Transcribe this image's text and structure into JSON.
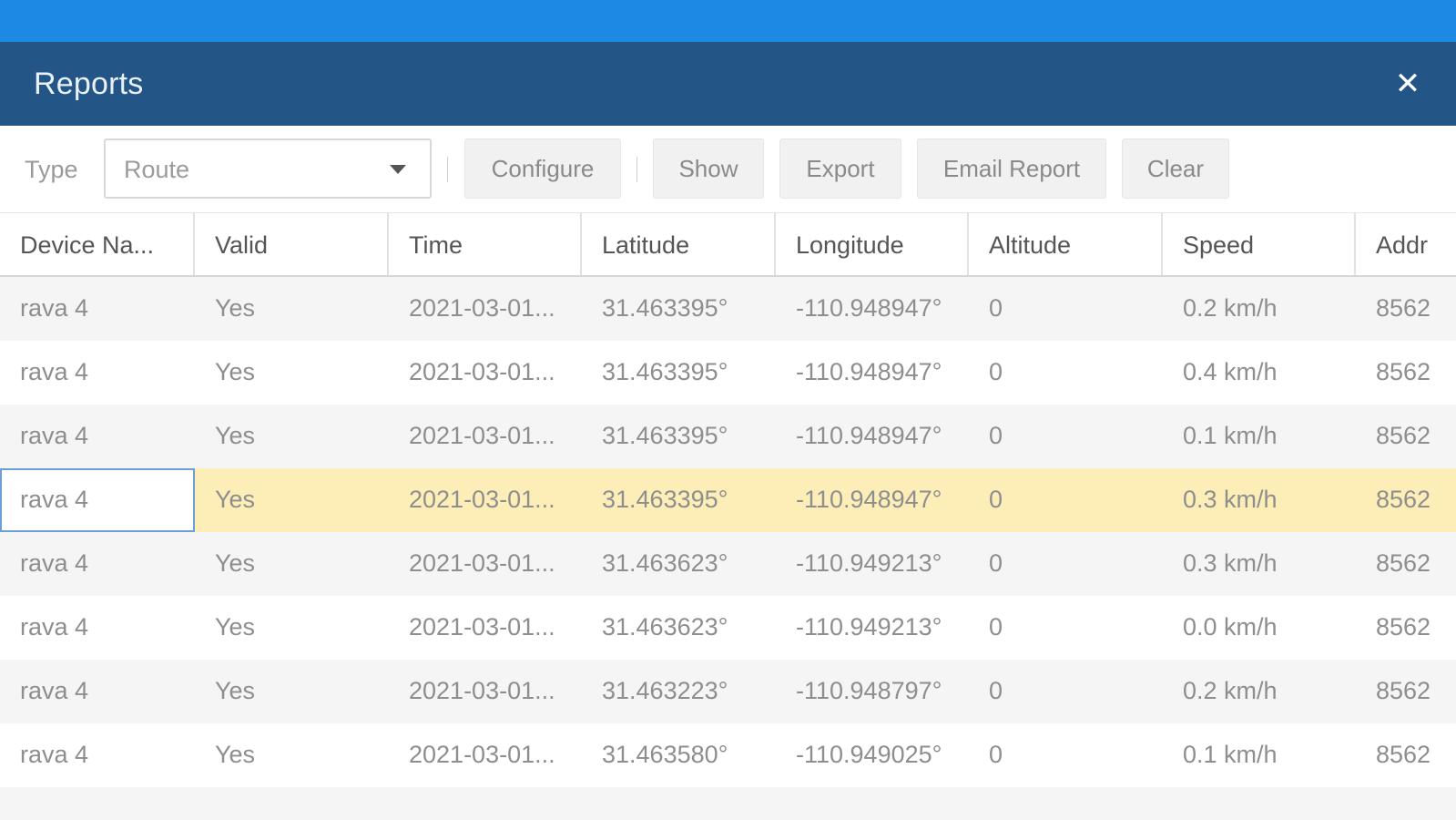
{
  "panel": {
    "title": "Reports",
    "close_label": "✕"
  },
  "toolbar": {
    "type_label": "Type",
    "type_value": "Route",
    "buttons": [
      {
        "label": "Configure"
      },
      {
        "label": "Show"
      },
      {
        "label": "Export"
      },
      {
        "label": "Email Report"
      },
      {
        "label": "Clear"
      }
    ]
  },
  "table": {
    "columns": [
      "Device Na...",
      "Valid",
      "Time",
      "Latitude",
      "Longitude",
      "Altitude",
      "Speed",
      "Addr"
    ],
    "rows": [
      [
        "rava 4",
        "Yes",
        "2021-03-01...",
        "31.463395°",
        "-110.948947°",
        "0",
        "0.2 km/h",
        "8562"
      ],
      [
        "rava 4",
        "Yes",
        "2021-03-01...",
        "31.463395°",
        "-110.948947°",
        "0",
        "0.4 km/h",
        "8562"
      ],
      [
        "rava 4",
        "Yes",
        "2021-03-01...",
        "31.463395°",
        "-110.948947°",
        "0",
        "0.1 km/h",
        "8562"
      ],
      [
        "rava 4",
        "Yes",
        "2021-03-01...",
        "31.463395°",
        "-110.948947°",
        "0",
        "0.3 km/h",
        "8562"
      ],
      [
        "rava 4",
        "Yes",
        "2021-03-01...",
        "31.463623°",
        "-110.949213°",
        "0",
        "0.3 km/h",
        "8562"
      ],
      [
        "rava 4",
        "Yes",
        "2021-03-01...",
        "31.463623°",
        "-110.949213°",
        "0",
        "0.0 km/h",
        "8562"
      ],
      [
        "rava 4",
        "Yes",
        "2021-03-01...",
        "31.463223°",
        "-110.948797°",
        "0",
        "0.2 km/h",
        "8562"
      ],
      [
        "rava 4",
        "Yes",
        "2021-03-01...",
        "31.463580°",
        "-110.949025°",
        "0",
        "0.1 km/h",
        "8562"
      ]
    ],
    "selected_row_index": 3
  },
  "colors": {
    "top_bar": "#1e88e5",
    "panel_header": "#245587",
    "selected_row": "#fdeeb8",
    "focus_border": "#6c9fd4"
  }
}
